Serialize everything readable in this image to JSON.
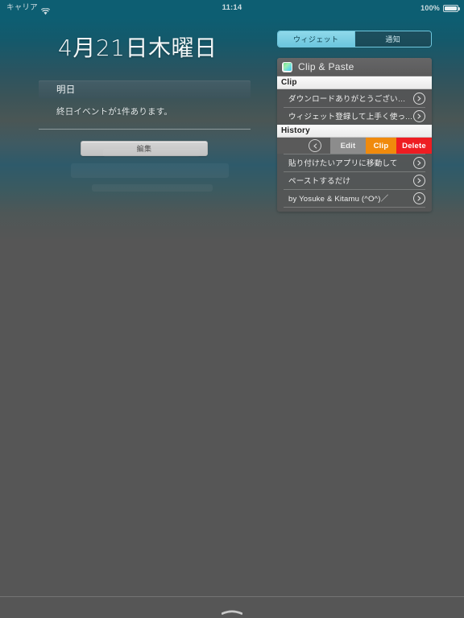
{
  "status_bar": {
    "carrier": "キャリア",
    "wifi_icon": "wifi-icon",
    "time": "11:14",
    "battery_percent": "100%",
    "battery_icon": "battery-full-icon"
  },
  "today_view": {
    "date_title": "4月21日木曜日",
    "calendar": {
      "section_label": "明日",
      "summary_text": "終日イベントが1件あります。"
    },
    "edit_button_label": "編集"
  },
  "segmented_control": {
    "options": [
      {
        "label": "ウィジェット",
        "selected": true
      },
      {
        "label": "通知",
        "selected": false
      }
    ]
  },
  "widget": {
    "app_icon": "clip-paste-app-icon",
    "title": "Clip & Paste",
    "sections": [
      {
        "header": "Clip",
        "rows": [
          {
            "label": "ダウンロードありがとうございます！",
            "accessory_icon": "chevron-right-circle-icon"
          },
          {
            "label": "ウィジェット登録して上手く使ってね",
            "accessory_icon": "chevron-right-circle-icon"
          }
        ]
      },
      {
        "header": "History",
        "toolbar": {
          "back_icon": "chevron-left-circle-icon",
          "buttons": [
            {
              "label": "Edit",
              "color": "#8c8c8c"
            },
            {
              "label": "Clip",
              "color": "#f08a0c"
            },
            {
              "label": "Delete",
              "color": "#ee1d22"
            }
          ]
        },
        "rows": [
          {
            "label": "貼り付けたいアプリに移動して",
            "accessory_icon": "chevron-right-circle-icon"
          },
          {
            "label": "ペーストするだけ",
            "accessory_icon": "chevron-right-circle-icon"
          },
          {
            "label": "by Yosuke & Kitamu (^O^)／",
            "accessory_icon": "chevron-right-circle-icon"
          }
        ]
      }
    ]
  },
  "bottom_bar": {
    "grabber_icon": "grabber-handle-icon"
  },
  "colors": {
    "accent_selected": "#6cc6de",
    "background_top": "#0d5e72",
    "background_bottom": "#565656",
    "clip_orange": "#f08a0c",
    "delete_red": "#ee1d22"
  }
}
